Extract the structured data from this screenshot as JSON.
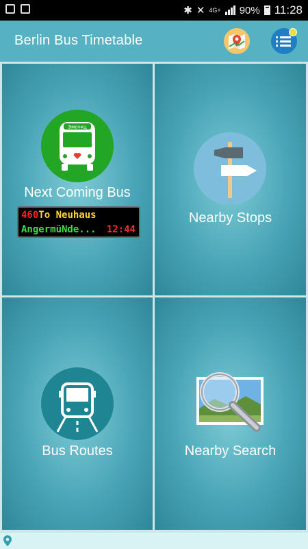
{
  "status_bar": {
    "battery": "90%",
    "time": "11:28",
    "network": "4G+"
  },
  "app_bar": {
    "title": "Berlin Bus Timetable",
    "map_button_icon": "map-pin-icon",
    "menu_button_icon": "list-menu-icon"
  },
  "tiles": {
    "next_bus": {
      "label": "Next Coming Bus",
      "icon": "bus-front-heart-icon",
      "bus_sign": "Эмочкц",
      "display": {
        "route": "460",
        "destination": "To Neuhaus",
        "stop": "AngermüNde...",
        "time": "12:44"
      }
    },
    "nearby_stops": {
      "label": "Nearby Stops",
      "icon": "signpost-icon"
    },
    "bus_routes": {
      "label": "Bus Routes",
      "icon": "bus-road-icon"
    },
    "nearby_search": {
      "label": "Nearby Search",
      "icon": "magnifier-photo-icon"
    }
  },
  "bottom_bar": {
    "icon": "location-pin-icon"
  },
  "colors": {
    "app_bar": "#56b2c2",
    "tile_center": "#7fcad6",
    "tile_edge": "#2f8799",
    "bus_green": "#23a626",
    "led_red": "#ff2020",
    "led_yellow": "#ffd43a",
    "led_green": "#3ee04a"
  }
}
